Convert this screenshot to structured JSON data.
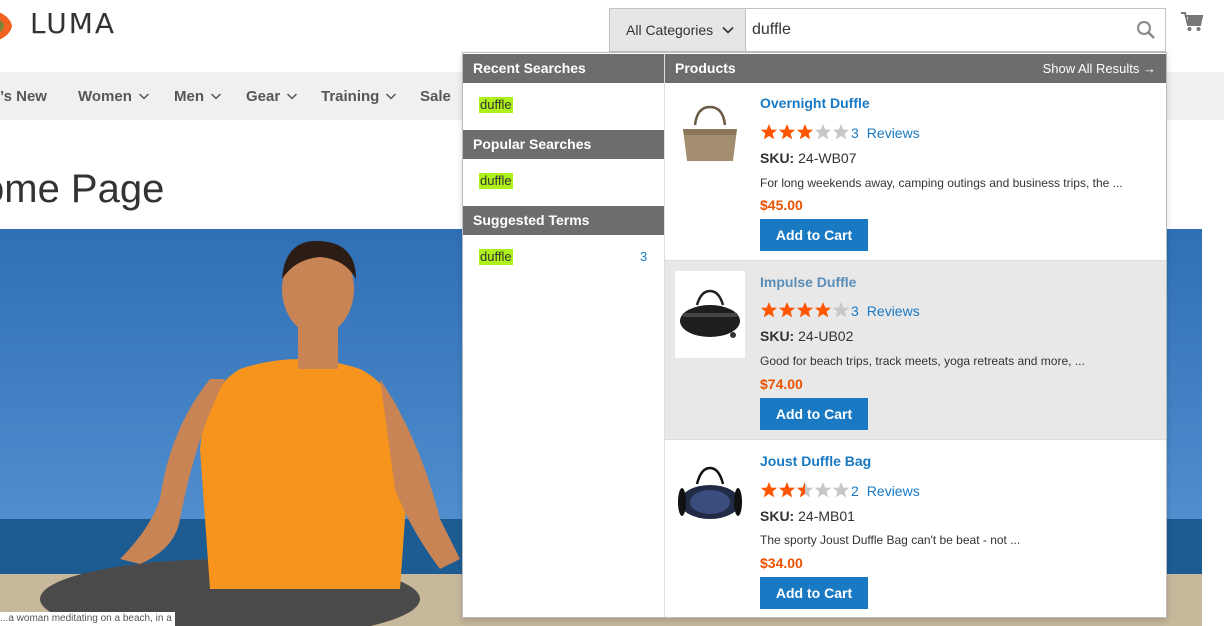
{
  "header": {
    "logo_text": "LUMA",
    "search": {
      "category_selected": "All Categories",
      "query": "duffle"
    }
  },
  "nav": {
    "items": [
      {
        "label": "’s New",
        "has_menu": false
      },
      {
        "label": "Women",
        "has_menu": true
      },
      {
        "label": "Men",
        "has_menu": true
      },
      {
        "label": "Gear",
        "has_menu": true
      },
      {
        "label": "Training",
        "has_menu": true
      },
      {
        "label": "Sale",
        "has_menu": false
      }
    ]
  },
  "page": {
    "title": "ome Page",
    "caption": "...a woman meditating on a beach, in a bright ..."
  },
  "autocomplete": {
    "recent_title": "Recent Searches",
    "recent_term": "duffle",
    "popular_title": "Popular Searches",
    "popular_term": "duffle",
    "suggested_title": "Suggested Terms",
    "suggested_term": "duffle",
    "suggested_count": "3",
    "products_title": "Products",
    "show_all": "Show All Results →",
    "products": [
      {
        "name": "Overnight Duffle",
        "rating": 3,
        "review_count": "3",
        "reviews_label": "Reviews",
        "sku_label": "SKU:",
        "sku": "24-WB07",
        "desc": "For long weekends away, camping outings and business trips, the ...",
        "price": "$45.00",
        "button": "Add to Cart"
      },
      {
        "name": "Impulse Duffle",
        "rating": 4,
        "review_count": "3",
        "reviews_label": "Reviews",
        "sku_label": "SKU:",
        "sku": "24-UB02",
        "desc": "Good for beach trips, track meets, yoga retreats and more, ...",
        "price": "$74.00",
        "button": "Add to Cart"
      },
      {
        "name": "Joust Duffle Bag",
        "rating": 2.5,
        "review_count": "2",
        "reviews_label": "Reviews",
        "sku_label": "SKU:",
        "sku": "24-MB01",
        "desc": "The sporty Joust Duffle Bag can't be beat - not ...",
        "price": "$34.00",
        "button": "Add to Cart"
      }
    ]
  },
  "colors": {
    "accent": "#1979c3",
    "price": "#eb5202",
    "star": "#ff5501",
    "highlight": "#aef01a",
    "section_header": "#6d6d6d"
  }
}
